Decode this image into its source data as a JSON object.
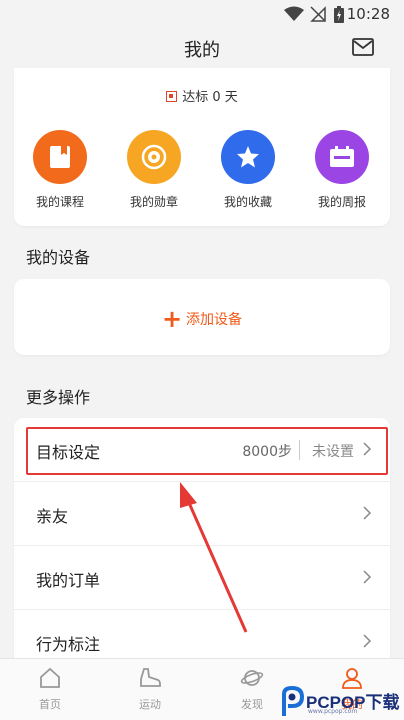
{
  "status_bar": {
    "time": "10:28"
  },
  "header": {
    "title": "我的"
  },
  "goal": {
    "text": "达标 0 天"
  },
  "quick_actions": [
    {
      "label": "我的课程",
      "icon": "course-icon",
      "color": "#f26a1b"
    },
    {
      "label": "我的勋章",
      "icon": "medal-icon",
      "color": "#f6a623"
    },
    {
      "label": "我的收藏",
      "icon": "star-icon",
      "color": "#2f6bea"
    },
    {
      "label": "我的周报",
      "icon": "report-icon",
      "color": "#9b45e4"
    }
  ],
  "devices": {
    "section_title": "我的设备",
    "add_label": "添加设备"
  },
  "more": {
    "section_title": "更多操作",
    "rows": [
      {
        "label": "目标设定",
        "value": "8000步",
        "status": "未设置"
      },
      {
        "label": "亲友"
      },
      {
        "label": "我的订单"
      },
      {
        "label": "行为标注"
      }
    ]
  },
  "tabs": [
    {
      "label": "首页",
      "icon": "home-icon"
    },
    {
      "label": "运动",
      "icon": "shoe-icon"
    },
    {
      "label": "发现",
      "icon": "planet-icon"
    },
    {
      "label": "我的",
      "icon": "person-icon",
      "active": true
    }
  ],
  "watermark": {
    "text": "PCPOP下载",
    "sub": "www.pcpop.com"
  },
  "colors": {
    "accent": "#f05a1a",
    "highlight": "#e53935"
  }
}
